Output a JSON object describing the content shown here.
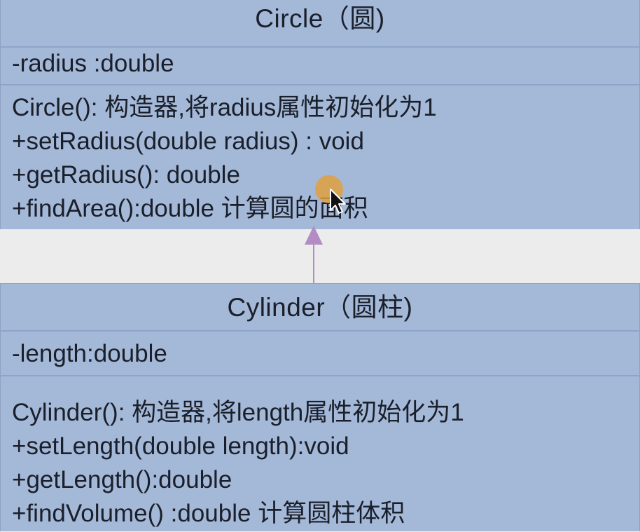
{
  "circle": {
    "name": "Circle（圆)",
    "attributes": [
      "-radius :double"
    ],
    "methods": [
      "Circle(): 构造器,将radius属性初始化为1",
      "+setRadius(double radius) : void",
      "+getRadius(): double",
      "+findArea():double  计算圆的面积"
    ]
  },
  "cylinder": {
    "name": "Cylinder（圆柱)",
    "attributes": [
      "-length:double"
    ],
    "methods": [
      "Cylinder():  构造器,将length属性初始化为1",
      "+setLength(double length):void",
      "+getLength():double",
      "+findVolume() :double   计算圆柱体积"
    ]
  },
  "colors": {
    "box_fill": "#a4b8d8",
    "divider": "#8ea5cb",
    "arrow": "#b48cc4",
    "cursor_highlight": "#e0a040"
  }
}
